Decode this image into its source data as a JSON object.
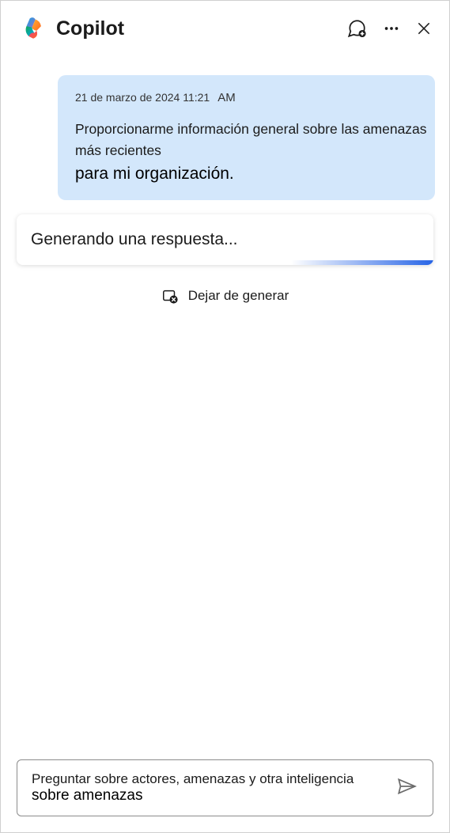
{
  "header": {
    "title": "Copilot"
  },
  "user_message": {
    "date": "21 de marzo de 2024 11:21",
    "ampm": "AM",
    "line1": "Proporcionarme información general sobre las amenazas más recientes",
    "line2": "para mi organización."
  },
  "generating": {
    "text": "Generando una respuesta..."
  },
  "stop": {
    "label": "Dejar de generar"
  },
  "input": {
    "line1": "Preguntar sobre actores, amenazas y otra inteligencia",
    "line2": "sobre amenazas"
  }
}
